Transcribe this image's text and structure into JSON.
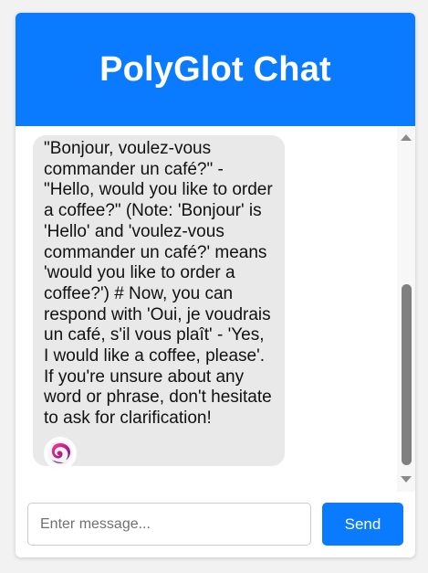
{
  "header": {
    "title": "PolyGlot Chat",
    "background_color": "#0a7bff"
  },
  "messages": [
    {
      "sender": "bot",
      "avatar_icon": "swirl-logo-icon",
      "text": "\"Bonjour, voulez-vous commander un café?\" - \"Hello, would you like to order a coffee?\" (Note: 'Bonjour' is 'Hello' and 'voulez-vous commander un café?' means 'would you like to order a coffee?') # Now, you can respond with 'Oui, je voudrais un café, s'il vous plaît' - 'Yes, I would like a coffee, please'. If you're unsure about any word or phrase, don't hesitate to ask for clarification!"
    }
  ],
  "composer": {
    "input_value": "",
    "input_placeholder": "Enter message...",
    "send_label": "Send",
    "send_color": "#0a7bff"
  }
}
